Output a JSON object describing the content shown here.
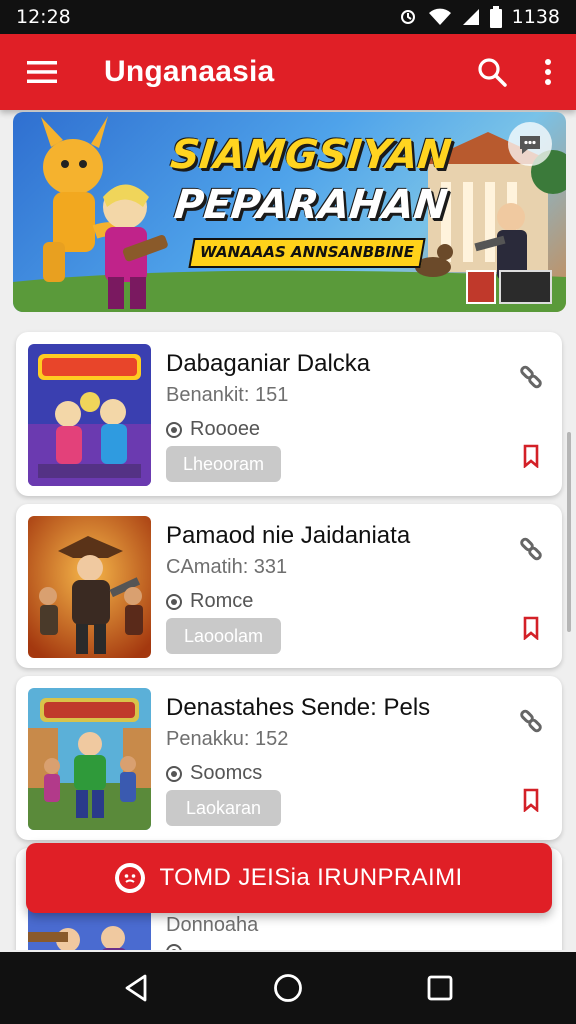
{
  "status_bar": {
    "time": "12:28",
    "battery_text": "1138",
    "icons": [
      "alarm-icon",
      "wifi-icon",
      "signal-icon",
      "battery-icon"
    ]
  },
  "app_bar": {
    "title": "Unganaasia",
    "icons": [
      "menu-icon",
      "search-icon",
      "more-vert-icon"
    ]
  },
  "banner": {
    "title_line1": "SIAMGSIYAN",
    "title_line2": "PEPARAHAN",
    "subtitle": "WANAAAS ANNSANBBINE"
  },
  "cards": [
    {
      "title": "Dabaganiar Dalcka",
      "meta": "Benankit: 151",
      "status": "Roooee",
      "button_label": "Lheooram",
      "palette": [
        "#3a3fb0",
        "#e3417a",
        "#ffcc22"
      ]
    },
    {
      "title": "Pamaod nie Jaidaniata",
      "meta": "CAmatih: 331",
      "status": "Romce",
      "button_label": "Laooolam",
      "palette": [
        "#b34a12",
        "#f08a24",
        "#2b2b2b"
      ]
    },
    {
      "title": "Denastahes Sende: Pels",
      "meta": "Penakku: 152",
      "status": "Soomcs",
      "button_label": "Laokaran",
      "palette": [
        "#2f8f3a",
        "#d8c34a",
        "#5a2b7a"
      ]
    },
    {
      "title": "",
      "meta": "Donnoaha",
      "status": "",
      "button_label": "",
      "palette": [
        "#4a6bd0",
        "#e08a2a",
        "#6a2f8a"
      ]
    }
  ],
  "cta": {
    "label": "TOMD JEISia IRUNPRAIMI"
  },
  "colors": {
    "primary": "#e01f26",
    "card_button": "#c9c9c9",
    "background": "#efefef"
  },
  "nav_bar": {
    "icons": [
      "back-icon",
      "home-icon",
      "recents-icon"
    ]
  }
}
